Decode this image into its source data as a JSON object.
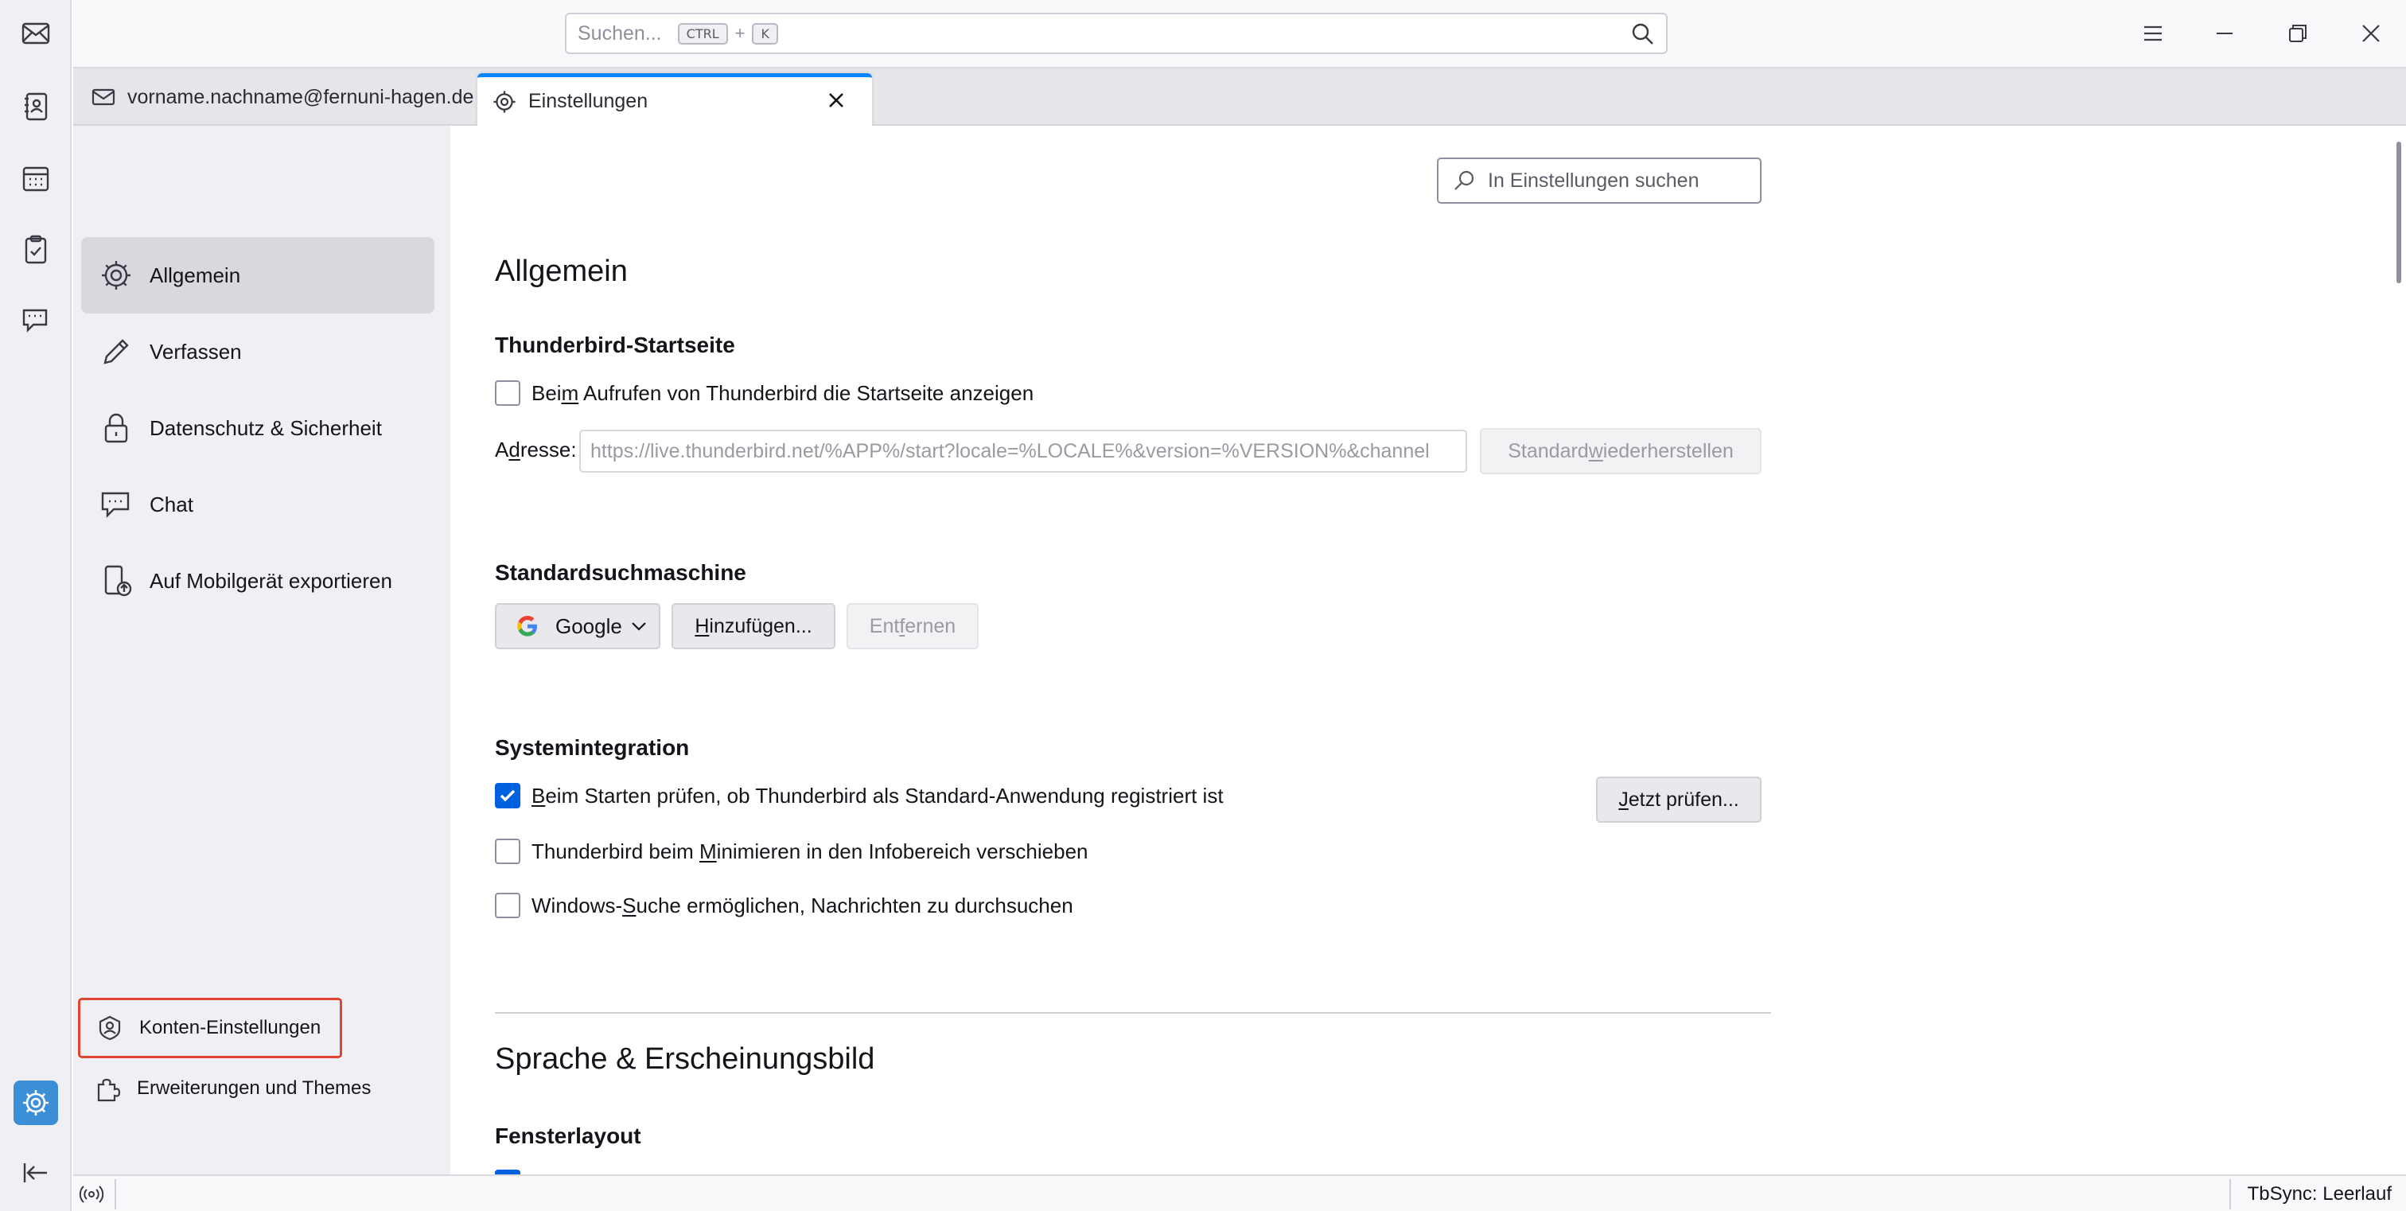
{
  "titlebar": {
    "search_placeholder": "Suchen...",
    "shortcut_key1": "CTRL",
    "shortcut_plus": "+",
    "shortcut_key2": "K"
  },
  "tabs": [
    {
      "label": "vorname.nachname@fernuni-hagen.de"
    },
    {
      "label": "Einstellungen"
    }
  ],
  "sidebar": {
    "categories": [
      {
        "label": "Allgemein"
      },
      {
        "label": "Verfassen"
      },
      {
        "label": "Datenschutz & Sicherheit"
      },
      {
        "label": "Chat"
      },
      {
        "label": "Auf Mobilgerät exportieren"
      }
    ],
    "account_settings_label": "Konten-Einstellungen",
    "addons_label": "Erweiterungen und Themes"
  },
  "main": {
    "search_placeholder": "In Einstellungen suchen",
    "section_general": "Allgemein",
    "startpage": {
      "heading": "Thunderbird-Startseite",
      "show_start_pre": "Bei",
      "show_start_key": "m",
      "show_start_post": " Aufrufen von Thunderbird die Startseite anzeigen",
      "show_start_checked": false,
      "address_pre": "A",
      "address_key": "d",
      "address_post": "resse:",
      "address_value": "https://live.thunderbird.net/%APP%/start?locale=%LOCALE%&version=%VERSION%&channel",
      "restore_pre": "Standard ",
      "restore_key": "w",
      "restore_post": "iederherstellen"
    },
    "search_engine": {
      "heading": "Standardsuchmaschine",
      "selected": "Google",
      "add_key": "H",
      "add_post": "inzufügen...",
      "remove_pre": "Ent",
      "remove_key": "f",
      "remove_post": "ernen"
    },
    "system_integration": {
      "heading": "Systemintegration",
      "check_default_key": "B",
      "check_default_post": "eim Starten prüfen, ob Thunderbird als Standard-Anwendung registriert ist",
      "check_default_checked": true,
      "check_now_key": "J",
      "check_now_post": "etzt prüfen...",
      "minimize_pre": "Thunderbird beim ",
      "minimize_key": "M",
      "minimize_post": "inimieren in den Infobereich verschieben",
      "minimize_checked": false,
      "windows_search_pre": "Windows-",
      "windows_search_key": "S",
      "windows_search_post": "uche ermöglichen, Nachrichten zu durchsuchen",
      "windows_search_checked": false
    },
    "section_language": "Sprache & Erscheinungsbild",
    "window_layout_heading": "Fensterlayout"
  },
  "statusbar": {
    "tbsync": "TbSync: Leerlauf"
  },
  "colors": {
    "accent": "#0061e0",
    "tab_highlight": "#0a84ff",
    "highlight_box": "#e0452f",
    "active_space": "#3b8fd6"
  },
  "icons": {
    "spaces": [
      "mail-icon",
      "address-book-icon",
      "calendar-icon",
      "tasks-icon",
      "chat-icon",
      "settings-icon",
      "collapse-icon"
    ]
  }
}
